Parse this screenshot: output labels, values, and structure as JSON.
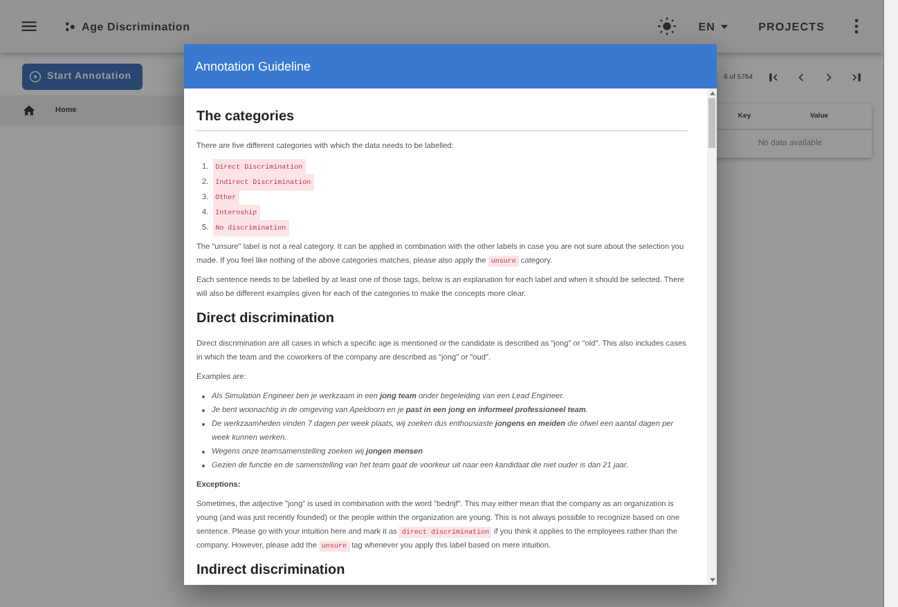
{
  "app_bar": {
    "title": "Age Discrimination",
    "language": "EN",
    "projects": "PROJECTS"
  },
  "toolbar": {
    "start_button": "Start Annotation",
    "position": "6 of 5764"
  },
  "breadcrumb": "Home",
  "metadata_table": {
    "columns": [
      "Key",
      "Value"
    ],
    "empty_text": "No data available"
  },
  "dialog": {
    "title": "Annotation Guideline",
    "blocks": [
      {
        "kind": "heading",
        "text": "The categories",
        "rule": true
      },
      {
        "kind": "paragraph",
        "segments": [
          {
            "kind": "text",
            "text": "There are five different categories with which the data needs to be labelled:"
          }
        ]
      },
      {
        "kind": "ordered_list",
        "items": [
          {
            "number": "1.",
            "segments": [
              {
                "kind": "code",
                "text": "Direct Discrimination"
              }
            ]
          },
          {
            "number": "2.",
            "segments": [
              {
                "kind": "code",
                "text": "Indirect Discrimination"
              }
            ]
          },
          {
            "number": "3.",
            "segments": [
              {
                "kind": "code",
                "text": "Other"
              }
            ]
          },
          {
            "number": "4.",
            "segments": [
              {
                "kind": "code",
                "text": "Internship"
              }
            ]
          },
          {
            "number": "5.",
            "segments": [
              {
                "kind": "code",
                "text": "No discrimination"
              }
            ]
          }
        ]
      },
      {
        "kind": "paragraph",
        "segments": [
          {
            "kind": "text",
            "text": "The \"unsure\" label is not a real category. It can be applied in combination with the other labels in case you are not sure about the selection you made. If you feel like nothing of the above categories matches, please also apply the"
          },
          {
            "kind": "code",
            "text": "unsure"
          },
          {
            "kind": "text",
            "text": "category."
          }
        ]
      },
      {
        "kind": "paragraph",
        "segments": [
          {
            "kind": "text",
            "text": "Each sentence needs to be labelled by at least one of those tags, below is an explanation for each label and when it should be selected. There will also be different examples given for each of the categories to make the concepts more clear."
          }
        ]
      },
      {
        "kind": "heading",
        "text": "Direct discrimination",
        "rule": false
      },
      {
        "kind": "paragraph",
        "segments": [
          {
            "kind": "text",
            "text": "Direct discrimination are all cases in which a specific age is mentioned or the candidate is described as \"jong\" or \"old\". This also includes cases in which the team and the coworkers of the company are described as \"jong\" or \"oud\"."
          }
        ]
      },
      {
        "kind": "paragraph",
        "segments": [
          {
            "kind": "text",
            "text": "Examples are:"
          }
        ]
      },
      {
        "kind": "bullet_list",
        "items": [
          "Als Simulation Engineer ben je werkzaam in een **jong team** onder begeleiding van een Lead Engineer.",
          "Je bent woonachtig in de omgeving van Apeldoorn en je **past in een jong en informeel professioneel team**.",
          "De werkzaamheden vinden 7 dagen per week plaats, wij zoeken dus enthousiaste **jongens en meiden** die ofwel een aantal dagen per week kunnen werken.",
          "Wegens onze teamsamenstelling zoeken wij **jongen mensen**",
          "Gezien de functie en de samenstelling van het team gaat de voorkeur uit naar een kandidaat die niet ouder is dan 21 jaar."
        ]
      },
      {
        "kind": "label",
        "text": "Exceptions:"
      },
      {
        "kind": "paragraph",
        "segments": [
          {
            "kind": "text",
            "text": "Sometimes, the adjective \"jong\" is used in combination with the word \"bedrijf\". This may either mean that the company as an organization is young (and was just recently founded) or the people within the organization are young. This is not always possible to recognize based on one sentence. Please go with your intuition here and mark it as"
          },
          {
            "kind": "code",
            "text": "direct discrimination"
          },
          {
            "kind": "text",
            "text": "if you think it applies to the employees rather than the company. However, please add the"
          },
          {
            "kind": "code",
            "text": "unsure"
          },
          {
            "kind": "text",
            "text": "tag whenever you apply this label based on mere intuition."
          }
        ]
      },
      {
        "kind": "heading",
        "text": "Indirect discrimination",
        "rule": false
      }
    ]
  }
}
